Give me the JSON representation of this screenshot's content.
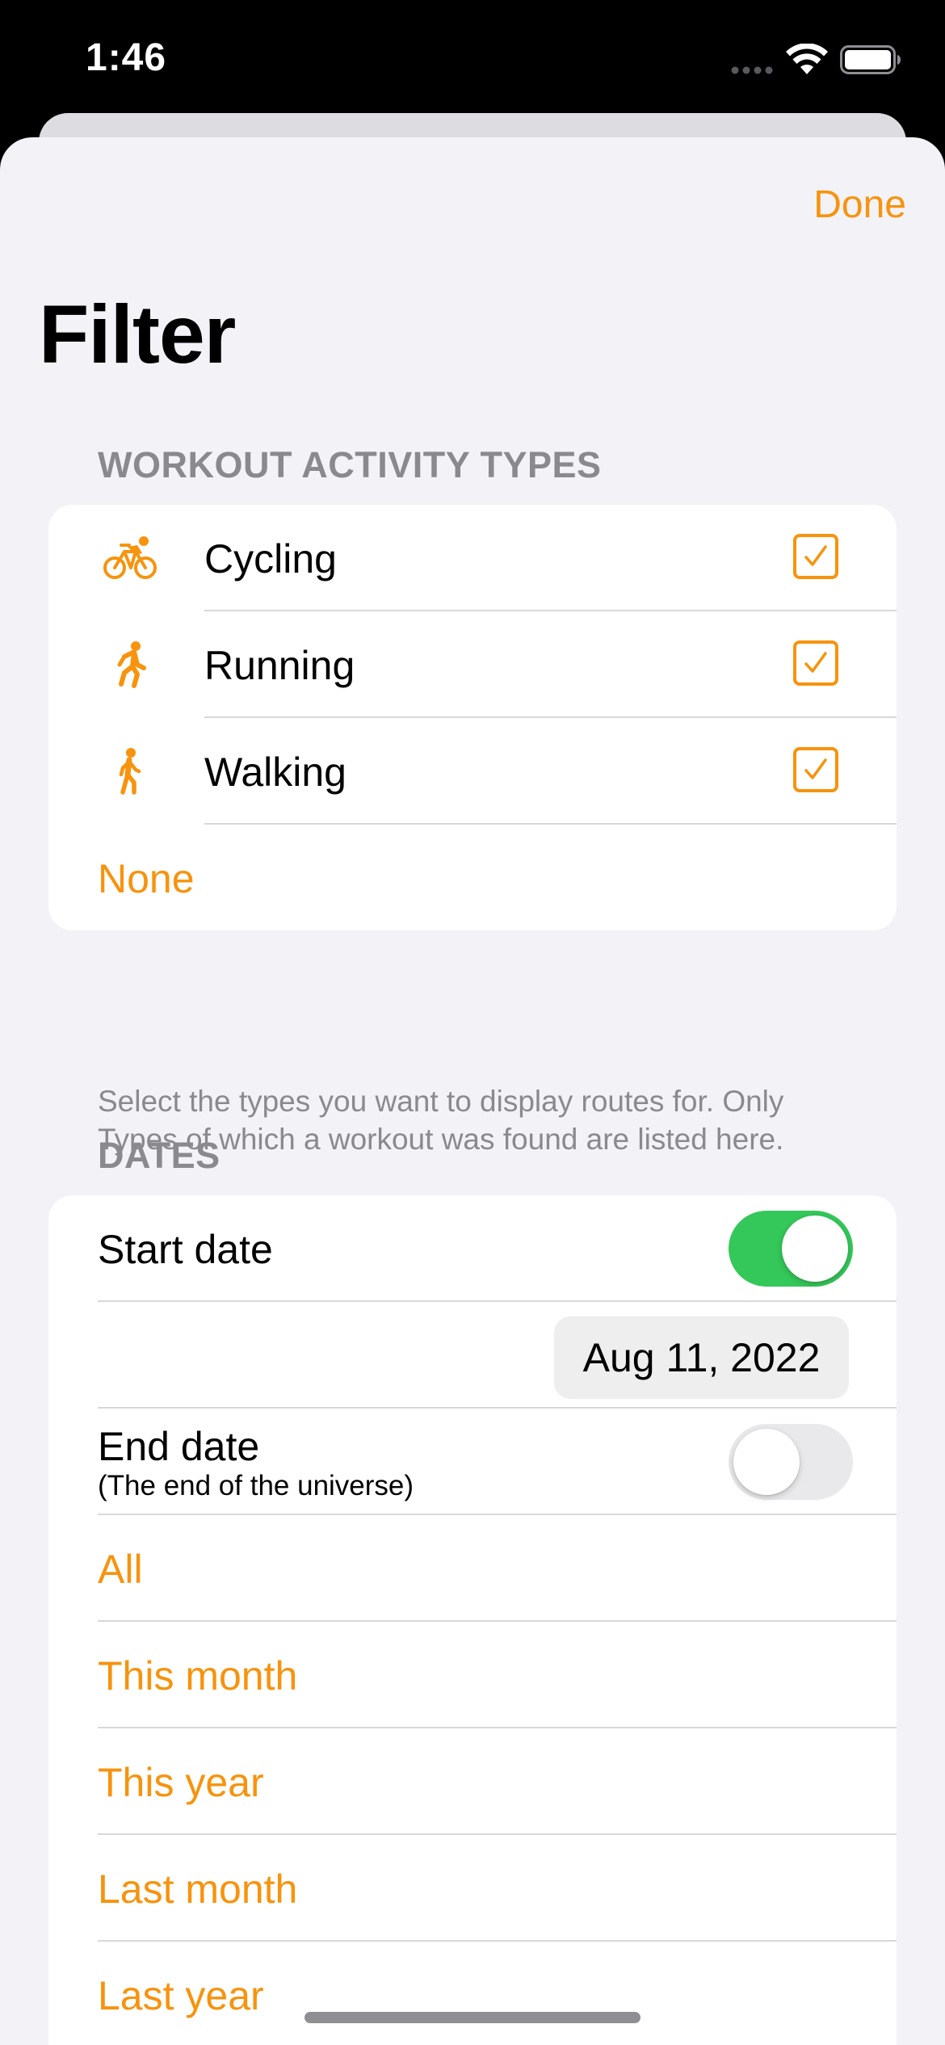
{
  "status_bar": {
    "time": "1:46"
  },
  "header": {
    "done_label": "Done",
    "title": "Filter"
  },
  "activity_section": {
    "header": "WORKOUT ACTIVITY TYPES",
    "items": [
      {
        "label": "Cycling",
        "icon": "bicycle-icon",
        "checked": true
      },
      {
        "label": "Running",
        "icon": "running-figure-icon",
        "checked": true
      },
      {
        "label": "Walking",
        "icon": "walking-figure-icon",
        "checked": true
      }
    ],
    "none_label": "None",
    "footnote": "Select the types you want to display routes for. Only Types of which a workout was found are listed here."
  },
  "dates_section": {
    "header": "DATES",
    "start_date_label": "Start date",
    "start_date_enabled": true,
    "start_date_value": "Aug 11, 2022",
    "end_date_label": "End date",
    "end_date_sublabel": "(The end of the universe)",
    "end_date_enabled": false,
    "presets": [
      "All",
      "This month",
      "This year",
      "Last month",
      "Last year"
    ]
  },
  "colors": {
    "accent": "#f7930d",
    "toggle_on": "#34c759",
    "toggle_off": "#e9e9eb",
    "sheet_background": "#f2f2f7",
    "secondary_text": "#8a8a8e"
  }
}
